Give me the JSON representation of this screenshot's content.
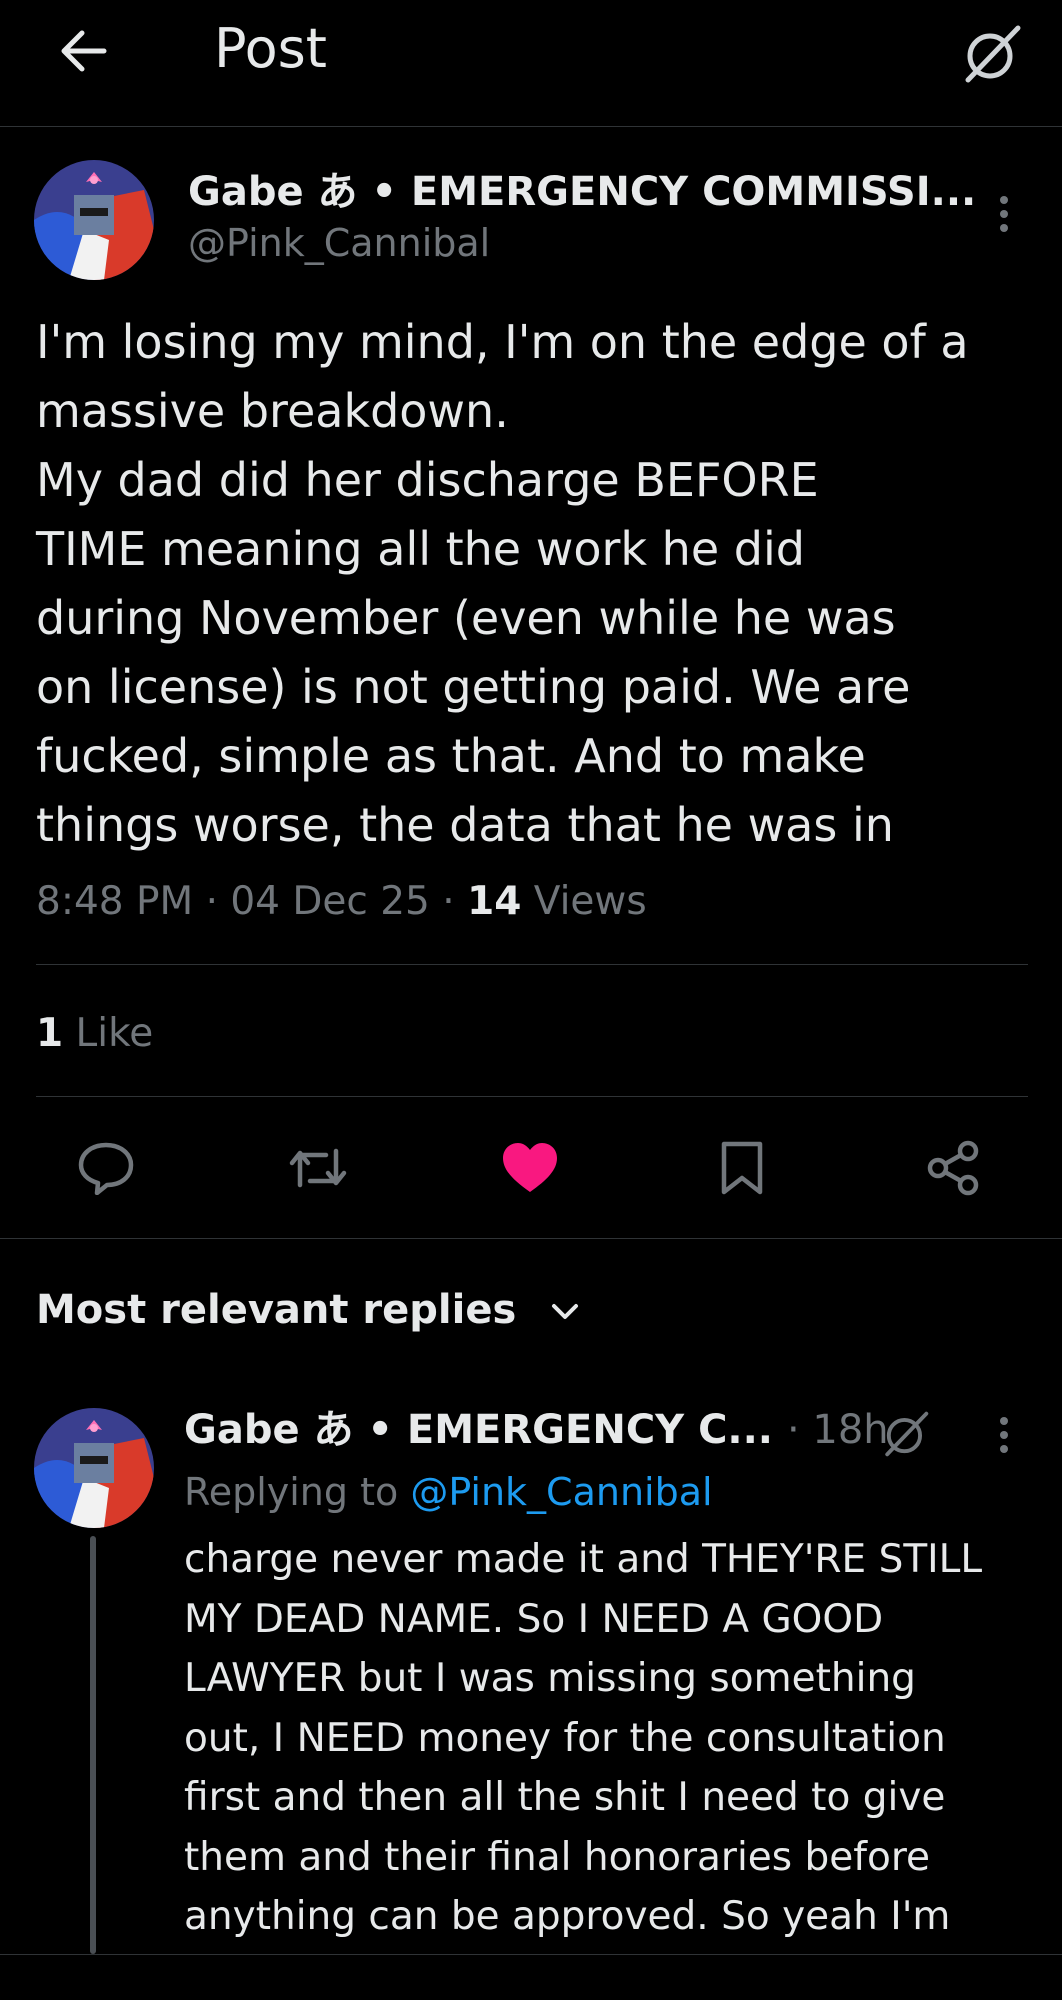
{
  "header": {
    "title": "Post"
  },
  "post": {
    "author_name": "Gabe あ • EMERGENCY COMMISSI...",
    "handle": "@Pink_Cannibal",
    "text_lines": [
      "I'm losing my mind, I'm on the edge of a",
      "massive breakdown.",
      "My dad did her discharge BEFORE",
      "TIME meaning all the work he did",
      "during November (even while he was",
      "on license) is not getting paid. We are",
      "fucked, simple as that. And to make",
      "things worse, the data that he was in"
    ],
    "time": "8:48 PM",
    "date": "04 Dec 25",
    "views_count": "14",
    "views_label": "Views",
    "likes_count": "1",
    "likes_label": "Like"
  },
  "actions": {
    "icons": [
      "reply-icon",
      "repost-icon",
      "like-icon",
      "bookmark-icon",
      "share-icon"
    ],
    "like_color": "#f91880"
  },
  "replies": {
    "header_label": "Most relevant replies",
    "items": [
      {
        "author_name": "Gabe あ • EMERGENCY C...",
        "time": "18h",
        "replying_label": "Replying to",
        "replying_handle": "@Pink_Cannibal",
        "text_lines": [
          "charge never made it and THEY'RE STILL",
          "MY DEAD NAME. So I NEED A GOOD",
          "LAWYER but I was missing something",
          "out, I NEED money for the consultation",
          "first and then all the shit I need to give",
          "them and their final honoraries before",
          "anything can be approved. So yeah I'm"
        ]
      }
    ]
  },
  "colors": {
    "background": "#000000",
    "text_primary": "#e7e9ea",
    "text_secondary": "#71767b",
    "link": "#1d9bf0",
    "divider": "#2f3336"
  }
}
